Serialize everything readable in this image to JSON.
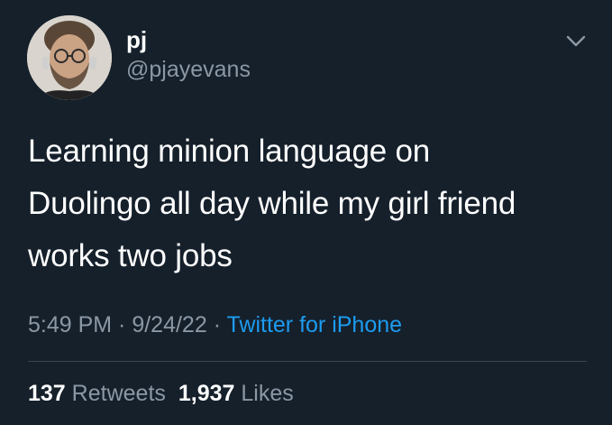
{
  "user": {
    "display_name": "pj",
    "handle": "@pjayevans"
  },
  "tweet": {
    "lines": [
      "Learning minion language on",
      "Duolingo all day while my girl friend",
      "works two jobs"
    ]
  },
  "meta": {
    "time": "5:49 PM",
    "separator": " · ",
    "date": "9/24/22",
    "source": "Twitter for iPhone"
  },
  "stats": {
    "retweets_count": "137",
    "retweets_label": "Retweets",
    "likes_count": "1,937",
    "likes_label": "Likes"
  },
  "icons": {
    "menu": "chevron-down-icon"
  },
  "colors": {
    "background": "#15202b",
    "text_primary": "#ffffff",
    "text_secondary": "#8b98a5",
    "link": "#1d9bf0",
    "divider": "#38444d"
  }
}
